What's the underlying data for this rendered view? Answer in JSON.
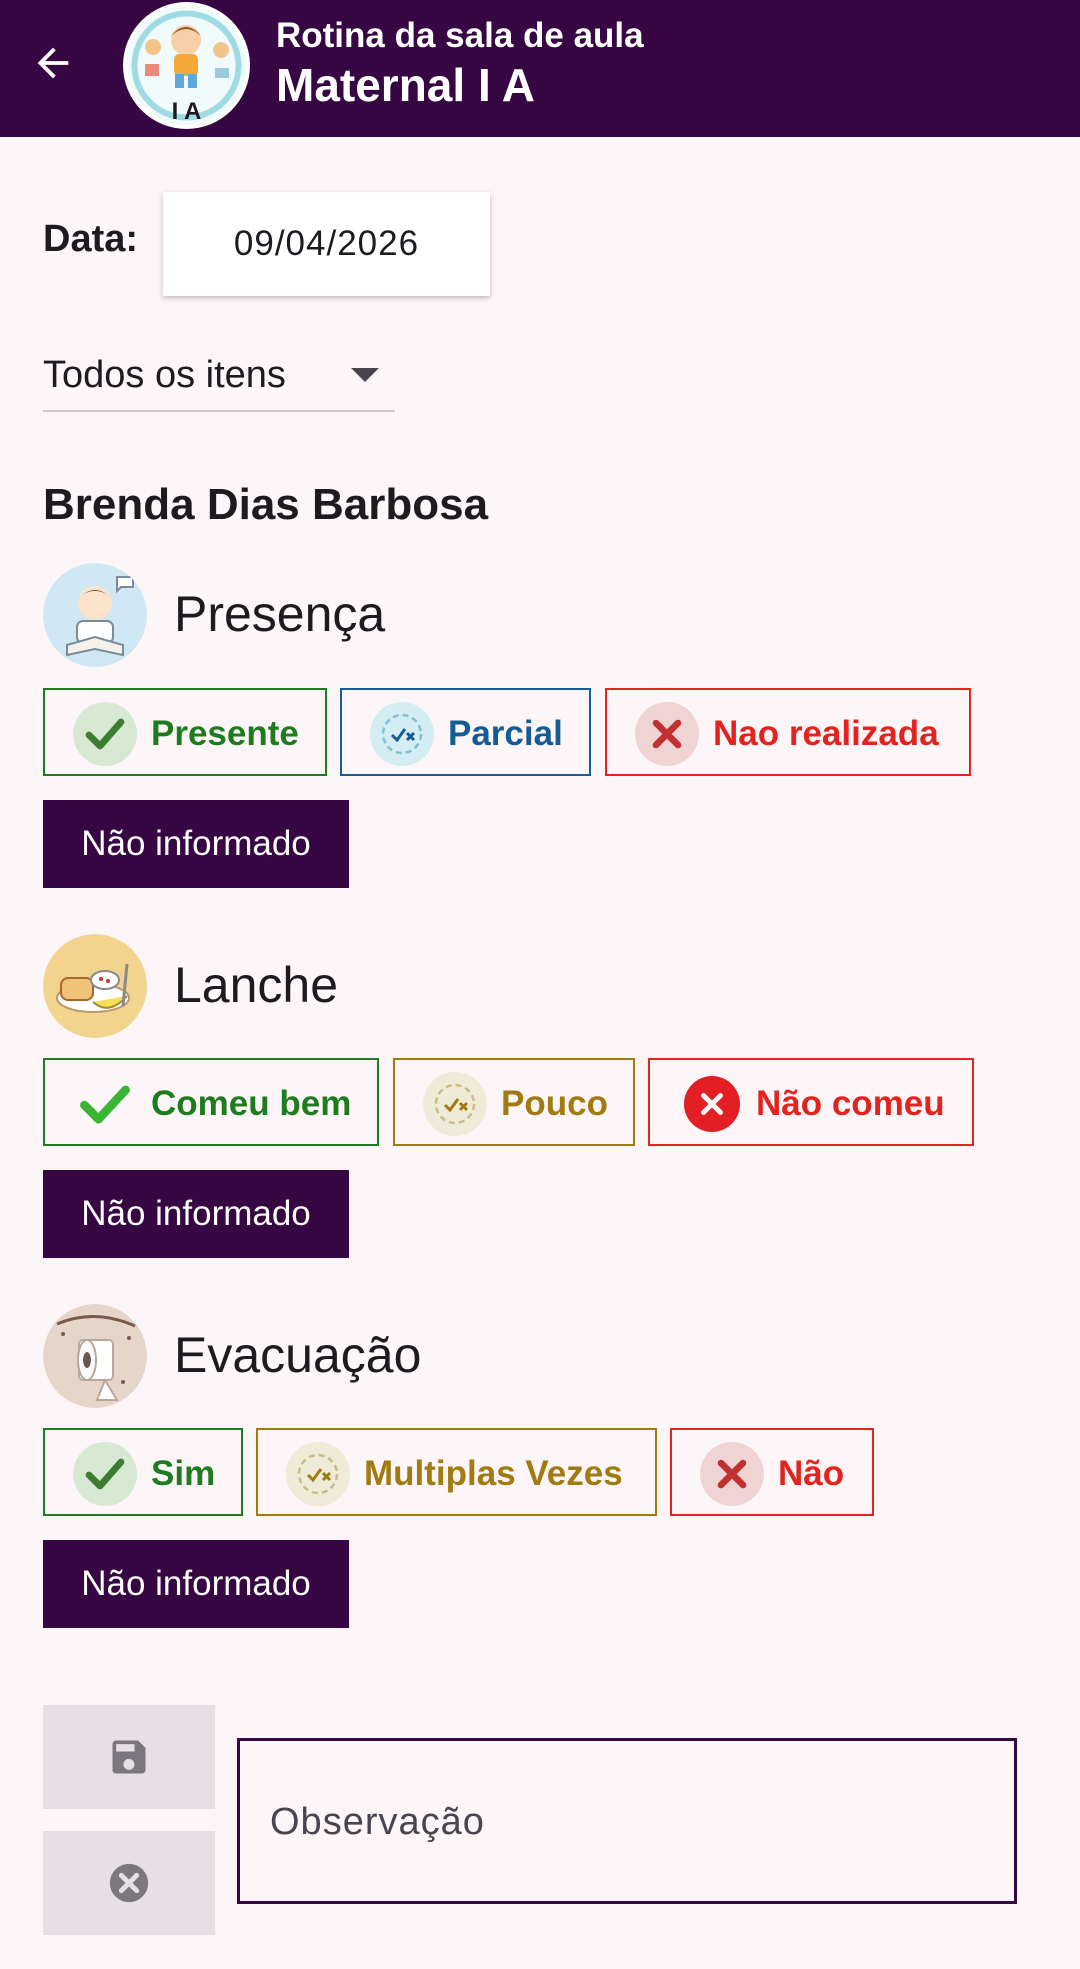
{
  "header": {
    "subtitle": "Rotina da sala de aula",
    "title": "Maternal I A",
    "logo_text": "I A"
  },
  "date": {
    "label": "Data:",
    "value": "09/04/2026"
  },
  "filter": {
    "selected": "Todos os itens"
  },
  "student": {
    "name": "Brenda Dias Barbosa"
  },
  "categories": [
    {
      "title": "Presença",
      "icon": "student-reading-icon",
      "options": [
        {
          "label": "Presente",
          "icon": "check-icon",
          "color": "#1e7b1e"
        },
        {
          "label": "Parcial",
          "icon": "partial-icon",
          "color": "#155b96"
        },
        {
          "label": "Nao realizada",
          "icon": "cross-icon",
          "color": "#e3231d"
        }
      ],
      "not_informed": "Não informado"
    },
    {
      "title": "Lanche",
      "icon": "snack-plate-icon",
      "options": [
        {
          "label": "Comeu bem",
          "icon": "check-icon",
          "color": "#1e7b1e"
        },
        {
          "label": "Pouco",
          "icon": "partial-icon",
          "color": "#a17b10"
        },
        {
          "label": "Não comeu",
          "icon": "cross-circle-icon",
          "color": "#e3231d"
        }
      ],
      "not_informed": "Não informado"
    },
    {
      "title": "Evacuação",
      "icon": "toilet-paper-icon",
      "options": [
        {
          "label": "Sim",
          "icon": "check-icon",
          "color": "#1e7b1e"
        },
        {
          "label": "Multiplas Vezes",
          "icon": "partial-icon",
          "color": "#a17b10"
        },
        {
          "label": "Não",
          "icon": "cross-icon",
          "color": "#e3231d"
        }
      ],
      "not_informed": "Não informado"
    }
  ],
  "observation": {
    "placeholder": "Observação"
  },
  "colors": {
    "primary": "#360742",
    "background": "#fdf6f9"
  }
}
